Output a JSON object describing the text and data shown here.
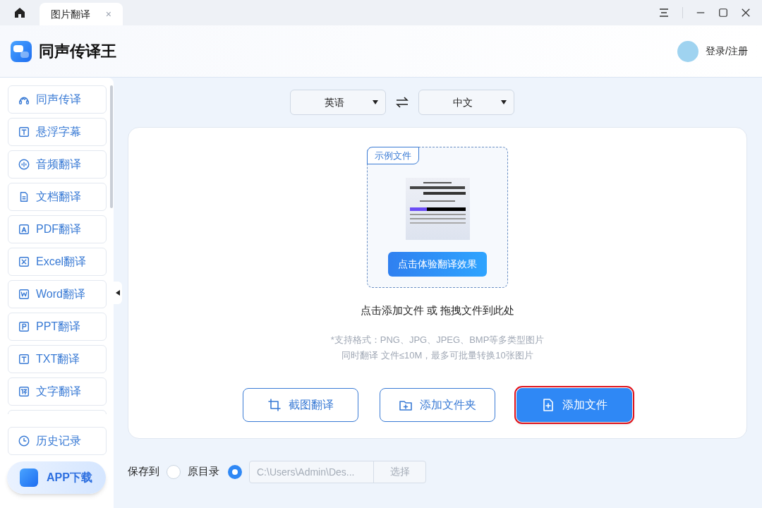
{
  "titlebar": {
    "tab": {
      "label": "图片翻译",
      "close": "×",
      "selected": true
    }
  },
  "header": {
    "app_name": "同声传译王",
    "login": "登录/注册"
  },
  "sidebar": {
    "items": [
      {
        "label": "同声传译",
        "kind": "headset",
        "selected": false
      },
      {
        "label": "悬浮字幕",
        "kind": "t",
        "selected": false
      },
      {
        "label": "音频翻译",
        "kind": "audio",
        "selected": false
      },
      {
        "label": "文档翻译",
        "kind": "doc",
        "selected": false
      },
      {
        "label": "PDF翻译",
        "kind": "pdf",
        "selected": false
      },
      {
        "label": "Excel翻译",
        "kind": "x",
        "selected": false
      },
      {
        "label": "Word翻译",
        "kind": "w",
        "selected": false
      },
      {
        "label": "PPT翻译",
        "kind": "p",
        "selected": false
      },
      {
        "label": "TXT翻译",
        "kind": "t",
        "selected": false
      },
      {
        "label": "文字翻译",
        "kind": "yi",
        "selected": false
      }
    ],
    "history": {
      "label": "历史记录"
    },
    "app_download": {
      "label": "APP下载"
    }
  },
  "languages": {
    "source": "英语",
    "target": "中文"
  },
  "upload": {
    "sample": {
      "tag": "示例文件",
      "button": "点击体验翻译效果"
    },
    "prompt": "点击添加文件 或 拖拽文件到此处",
    "notes": [
      "*支持格式：PNG、JPG、JPEG、BMP等多类型图片",
      "同时翻译 文件≤10M，最多可批量转换10张图片"
    ],
    "buttons": [
      {
        "label": "截图翻译",
        "kind": "crop",
        "highlighted": false
      },
      {
        "label": "添加文件夹",
        "kind": "folder",
        "highlighted": false
      },
      {
        "label": "添加文件",
        "kind": "file",
        "highlighted": true
      }
    ]
  },
  "save_to": {
    "label": "保存到",
    "options": [
      {
        "label": "原目录",
        "selected": false
      },
      {
        "path": "C:\\Users\\Admin\\Des...",
        "button": "选择",
        "selected": true
      }
    ]
  }
}
